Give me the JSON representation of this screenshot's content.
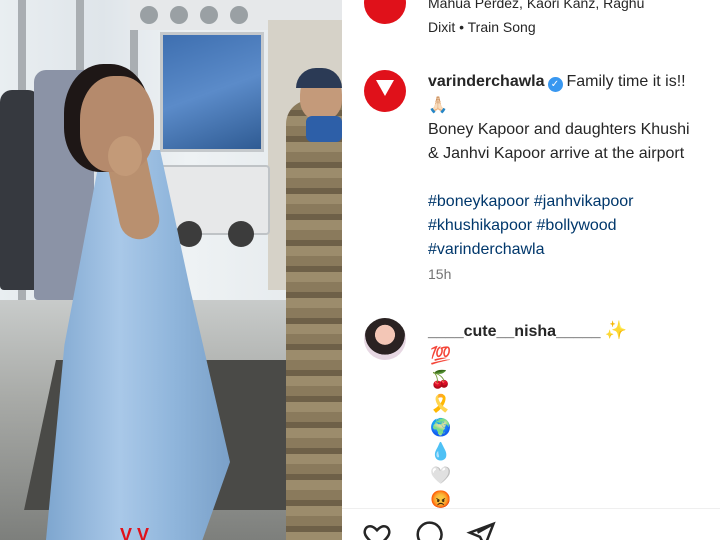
{
  "post": {
    "prev_snippet_line1": "Mahua Perdez, Kaori Kanz, Raghu",
    "prev_snippet_line2": "Dixit • Train Song",
    "username": "varinderchawla",
    "caption_first": "Family time it is!!",
    "caption_emoji": "🙏🏻",
    "caption_line2": "Boney Kapoor and daughters Khushi",
    "caption_line3": "& Janhvi Kapoor arrive at the airport",
    "hashtags_line1": "#boneykapoor #janhvikapoor",
    "hashtags_line2": "#khushikapoor #bollywood",
    "hashtags_line3": "#varinderchawla",
    "timestamp": "15h",
    "brand_color": "#e0111a",
    "verified_color": "#3897f0",
    "hashtag_color": "#00376b"
  },
  "comment": {
    "username": "____cute__nisha_____",
    "badge": "✨",
    "emojis": [
      "💯",
      "🍒",
      "🎗️",
      "🌍",
      "💧",
      "🤍",
      "😡"
    ]
  },
  "actions": {
    "like_icon": "heart-icon",
    "comment_icon": "comment-icon",
    "share_icon": "share-icon"
  }
}
